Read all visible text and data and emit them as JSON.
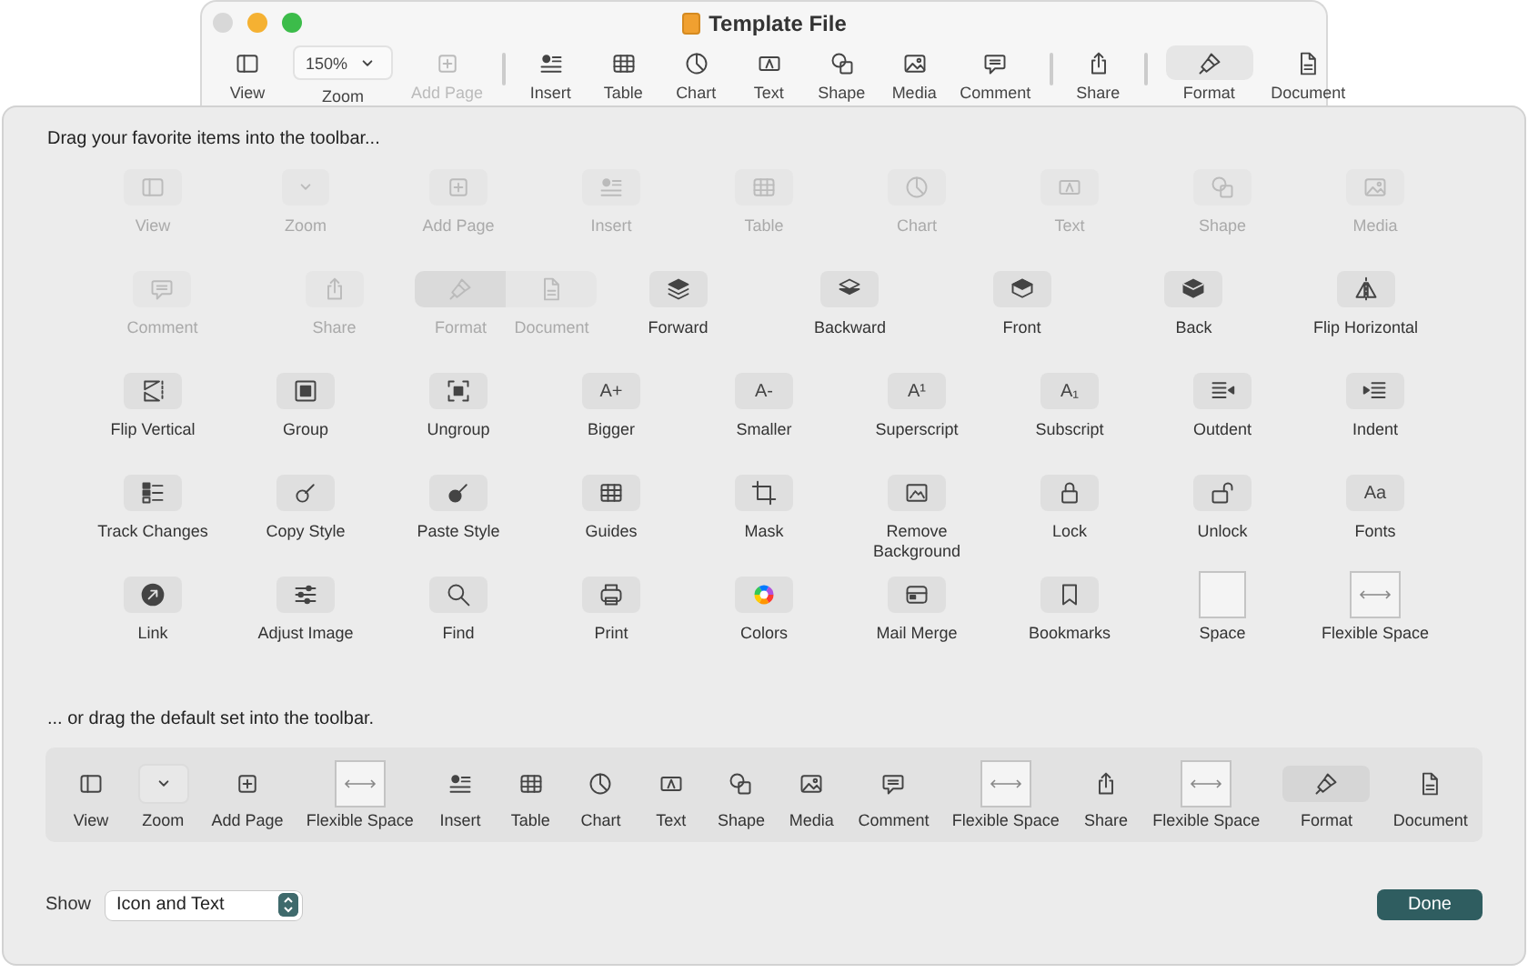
{
  "window": {
    "title": "Template File",
    "toolbar": [
      {
        "kind": "view",
        "label": "View",
        "disabled": false,
        "selected": false
      },
      {
        "kind": "zoom",
        "label": "Zoom",
        "value": "150%",
        "disabled": false,
        "selected": false
      },
      {
        "kind": "add-page",
        "label": "Add Page",
        "disabled": true,
        "selected": false
      },
      {
        "kind": "separator"
      },
      {
        "kind": "insert",
        "label": "Insert",
        "disabled": false,
        "selected": false
      },
      {
        "kind": "table",
        "label": "Table",
        "disabled": false,
        "selected": false
      },
      {
        "kind": "chart",
        "label": "Chart",
        "disabled": false,
        "selected": false
      },
      {
        "kind": "text",
        "label": "Text",
        "disabled": false,
        "selected": false
      },
      {
        "kind": "shape",
        "label": "Shape",
        "disabled": false,
        "selected": false
      },
      {
        "kind": "media",
        "label": "Media",
        "disabled": false,
        "selected": false
      },
      {
        "kind": "comment",
        "label": "Comment",
        "disabled": false,
        "selected": false
      },
      {
        "kind": "separator"
      },
      {
        "kind": "share",
        "label": "Share",
        "disabled": false,
        "selected": false
      },
      {
        "kind": "separator"
      },
      {
        "kind": "format",
        "label": "Format",
        "disabled": false,
        "selected": true
      },
      {
        "kind": "document",
        "label": "Document",
        "disabled": false,
        "selected": false
      }
    ]
  },
  "sheet": {
    "heading": "Drag your favorite items into the toolbar...",
    "palette": [
      [
        {
          "kind": "view",
          "label": "View",
          "disabled": true
        },
        {
          "kind": "zoom",
          "label": "Zoom",
          "disabled": true
        },
        {
          "kind": "add-page",
          "label": "Add Page",
          "disabled": true
        },
        {
          "kind": "insert",
          "label": "Insert",
          "disabled": true
        },
        {
          "kind": "table",
          "label": "Table",
          "disabled": true
        },
        {
          "kind": "chart",
          "label": "Chart",
          "disabled": true
        },
        {
          "kind": "text",
          "label": "Text",
          "disabled": true
        },
        {
          "kind": "shape",
          "label": "Shape",
          "disabled": true
        },
        {
          "kind": "media",
          "label": "Media",
          "disabled": true
        }
      ],
      [
        {
          "kind": "comment",
          "label": "Comment",
          "disabled": true
        },
        {
          "kind": "share",
          "label": "Share",
          "disabled": true
        },
        {
          "kind": "group",
          "disabled": true,
          "items": [
            {
              "kind": "format",
              "label": "Format",
              "selected": true
            },
            {
              "kind": "document",
              "label": "Document",
              "selected": false
            }
          ]
        },
        {
          "kind": "forward",
          "label": "Forward",
          "disabled": false
        },
        {
          "kind": "backward",
          "label": "Backward",
          "disabled": false
        },
        {
          "kind": "front",
          "label": "Front",
          "disabled": false
        },
        {
          "kind": "back",
          "label": "Back",
          "disabled": false
        },
        {
          "kind": "flip-h",
          "label": "Flip Horizontal",
          "disabled": false
        }
      ],
      [
        {
          "kind": "flip-v",
          "label": "Flip Vertical",
          "disabled": false
        },
        {
          "kind": "group-objects",
          "label": "Group",
          "disabled": false
        },
        {
          "kind": "ungroup",
          "label": "Ungroup",
          "disabled": false
        },
        {
          "kind": "glyph",
          "glyph": "A+",
          "label": "Bigger",
          "disabled": false
        },
        {
          "kind": "glyph",
          "glyph": "A-",
          "label": "Smaller",
          "disabled": false
        },
        {
          "kind": "glyph",
          "glyph": "A¹",
          "label": "Superscript",
          "disabled": false
        },
        {
          "kind": "glyph",
          "glyph": "A₁",
          "label": "Subscript",
          "disabled": false
        },
        {
          "kind": "outdent",
          "label": "Outdent",
          "disabled": false
        },
        {
          "kind": "indent",
          "label": "Indent",
          "disabled": false
        }
      ],
      [
        {
          "kind": "track",
          "label": "Track Changes",
          "disabled": false
        },
        {
          "kind": "copy-style",
          "label": "Copy Style",
          "disabled": false
        },
        {
          "kind": "paste-style",
          "label": "Paste Style",
          "disabled": false
        },
        {
          "kind": "guides",
          "label": "Guides",
          "disabled": false
        },
        {
          "kind": "mask",
          "label": "Mask",
          "disabled": false
        },
        {
          "kind": "remove-bg",
          "label": "Remove Background",
          "disabled": false
        },
        {
          "kind": "lock",
          "label": "Lock",
          "disabled": false
        },
        {
          "kind": "unlock",
          "label": "Unlock",
          "disabled": false
        },
        {
          "kind": "glyph",
          "glyph": "Aa",
          "label": "Fonts",
          "disabled": false
        }
      ],
      [
        {
          "kind": "link",
          "label": "Link",
          "disabled": false
        },
        {
          "kind": "adjust",
          "label": "Adjust Image",
          "disabled": false
        },
        {
          "kind": "find",
          "label": "Find",
          "disabled": false
        },
        {
          "kind": "print",
          "label": "Print",
          "disabled": false
        },
        {
          "kind": "colors",
          "label": "Colors",
          "disabled": false
        },
        {
          "kind": "mail-merge",
          "label": "Mail Merge",
          "disabled": false
        },
        {
          "kind": "bookmarks",
          "label": "Bookmarks",
          "disabled": false
        },
        {
          "kind": "space",
          "label": "Space",
          "disabled": false
        },
        {
          "kind": "flex-space",
          "label": "Flexible Space",
          "disabled": false
        }
      ]
    ],
    "default_heading": "... or drag the default set into the toolbar.",
    "default_set": [
      {
        "kind": "view",
        "label": "View",
        "selected": false
      },
      {
        "kind": "zoom",
        "label": "Zoom",
        "selected": false
      },
      {
        "kind": "add-page",
        "label": "Add Page",
        "selected": false
      },
      {
        "kind": "flex-space",
        "label": "Flexible Space",
        "selected": false
      },
      {
        "kind": "insert",
        "label": "Insert",
        "selected": false
      },
      {
        "kind": "table",
        "label": "Table",
        "selected": false
      },
      {
        "kind": "chart",
        "label": "Chart",
        "selected": false
      },
      {
        "kind": "text",
        "label": "Text",
        "selected": false
      },
      {
        "kind": "shape",
        "label": "Shape",
        "selected": false
      },
      {
        "kind": "media",
        "label": "Media",
        "selected": false
      },
      {
        "kind": "comment",
        "label": "Comment",
        "selected": false
      },
      {
        "kind": "flex-space",
        "label": "Flexible Space",
        "selected": false
      },
      {
        "kind": "share",
        "label": "Share",
        "selected": false
      },
      {
        "kind": "flex-space",
        "label": "Flexible Space",
        "selected": false
      },
      {
        "kind": "format",
        "label": "Format",
        "selected": true
      },
      {
        "kind": "document",
        "label": "Document",
        "selected": false
      }
    ],
    "show": {
      "label": "Show",
      "value": "Icon and Text"
    },
    "done": "Done"
  }
}
